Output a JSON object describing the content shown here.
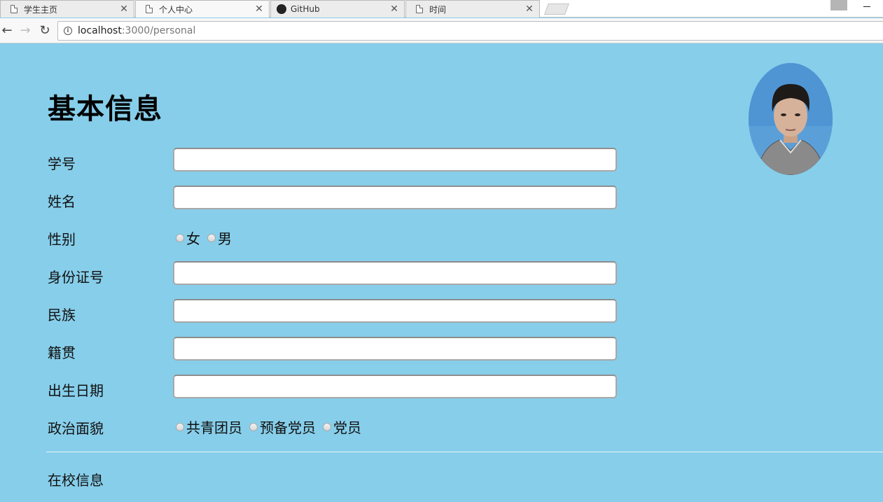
{
  "browser": {
    "tabs": [
      {
        "title": "学生主页",
        "icon": "document-icon",
        "active": false
      },
      {
        "title": "个人中心",
        "icon": "document-icon",
        "active": true
      },
      {
        "title": "GitHub",
        "icon": "github-icon",
        "active": false
      },
      {
        "title": "时间",
        "icon": "document-icon",
        "active": false
      }
    ],
    "url_host": "localhost",
    "url_path": ":3000/personal"
  },
  "page": {
    "title": "基本信息",
    "fields": {
      "student_id": {
        "label": "学号",
        "value": ""
      },
      "name": {
        "label": "姓名",
        "value": ""
      },
      "gender": {
        "label": "性别",
        "options": [
          "女",
          "男"
        ]
      },
      "id_number": {
        "label": "身份证号",
        "value": ""
      },
      "ethnicity": {
        "label": "民族",
        "value": ""
      },
      "native_place": {
        "label": "籍贯",
        "value": ""
      },
      "birth_date": {
        "label": "出生日期",
        "value": ""
      },
      "political_status": {
        "label": "政治面貌",
        "options": [
          "共青团员",
          "预备党员",
          "党员"
        ]
      }
    },
    "section2_title": "在校信息"
  },
  "colors": {
    "page_background": "#87ceea",
    "input_background": "#ffffff"
  }
}
